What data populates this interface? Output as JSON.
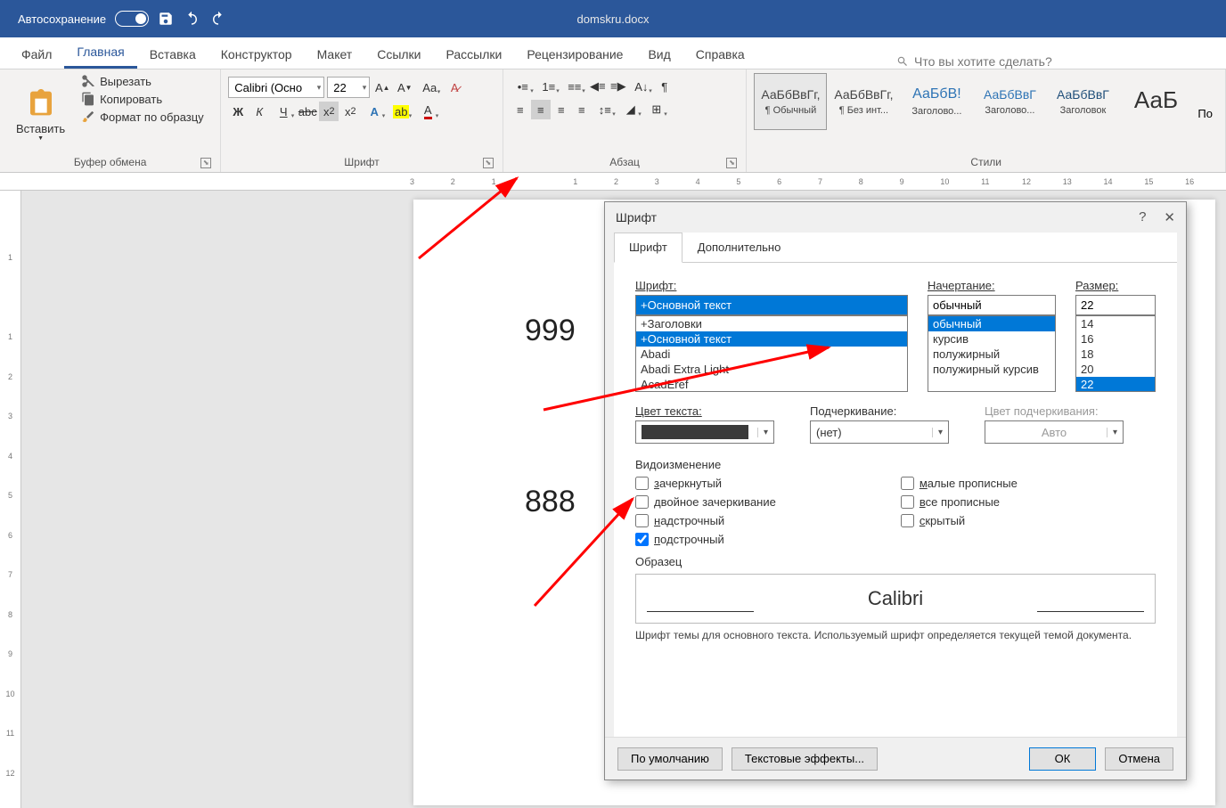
{
  "titlebar": {
    "autosave": "Автосохранение",
    "filename": "domskru.docx"
  },
  "tabs": [
    "Файл",
    "Главная",
    "Вставка",
    "Конструктор",
    "Макет",
    "Ссылки",
    "Рассылки",
    "Рецензирование",
    "Вид",
    "Справка"
  ],
  "active_tab": 1,
  "search_placeholder": "Что вы хотите сделать?",
  "ribbon": {
    "clipboard": {
      "label": "Буфер обмена",
      "paste": "Вставить",
      "cut": "Вырезать",
      "copy": "Копировать",
      "format": "Формат по образцу"
    },
    "font": {
      "label": "Шрифт",
      "name": "Calibri (Осно",
      "size": "22"
    },
    "paragraph": {
      "label": "Абзац"
    },
    "styles": {
      "label": "Стили",
      "items": [
        {
          "preview": "АаБбВвГг,",
          "name": "¶ Обычный",
          "sel": true
        },
        {
          "preview": "АаБбВвГг,",
          "name": "¶ Без инт..."
        },
        {
          "preview": "АаБбВ!",
          "name": "Заголово...",
          "color": "#2e74b5",
          "size": "16px"
        },
        {
          "preview": "АаБбВвГ",
          "name": "Заголово...",
          "color": "#2e74b5"
        },
        {
          "preview": "АаБбВвГ",
          "name": "Заголовок",
          "color": "#1f4e79"
        },
        {
          "preview": "АаБ",
          "name": "",
          "color": "#333",
          "size": "26px"
        }
      ]
    },
    "more": "По"
  },
  "document": {
    "line1": "999",
    "line2": "888"
  },
  "dialog": {
    "title": "Шрифт",
    "tabs": [
      "Шрифт",
      "Дополнительно"
    ],
    "font_label": "Шрифт:",
    "font_value": "+Основной текст",
    "font_list": [
      "+Заголовки",
      "+Основной текст",
      "Abadi",
      "Abadi Extra Light",
      "AcadEref"
    ],
    "font_list_sel": 1,
    "style_label": "Начертание:",
    "style_value": "обычный",
    "style_list": [
      "обычный",
      "курсив",
      "полужирный",
      "полужирный курсив"
    ],
    "style_list_sel": 0,
    "size_label": "Размер:",
    "size_value": "22",
    "size_list": [
      "14",
      "16",
      "18",
      "20",
      "22"
    ],
    "size_list_sel": 4,
    "color_label": "Цвет текста:",
    "underline_label": "Подчеркивание:",
    "underline_value": "(нет)",
    "ulcolor_label": "Цвет подчеркивания:",
    "ulcolor_value": "Авто",
    "effects_label": "Видоизменение",
    "effects_left": [
      "зачеркнутый",
      "двойное зачеркивание",
      "надстрочный",
      "подстрочный"
    ],
    "effects_left_checked": 3,
    "effects_right": [
      "малые прописные",
      "все прописные",
      "скрытый"
    ],
    "sample_label": "Образец",
    "sample_text": "Calibri",
    "desc": "Шрифт темы для основного текста. Используемый шрифт определяется текущей темой документа.",
    "btn_default": "По умолчанию",
    "btn_effects": "Текстовые эффекты...",
    "btn_ok": "ОК",
    "btn_cancel": "Отмена"
  }
}
